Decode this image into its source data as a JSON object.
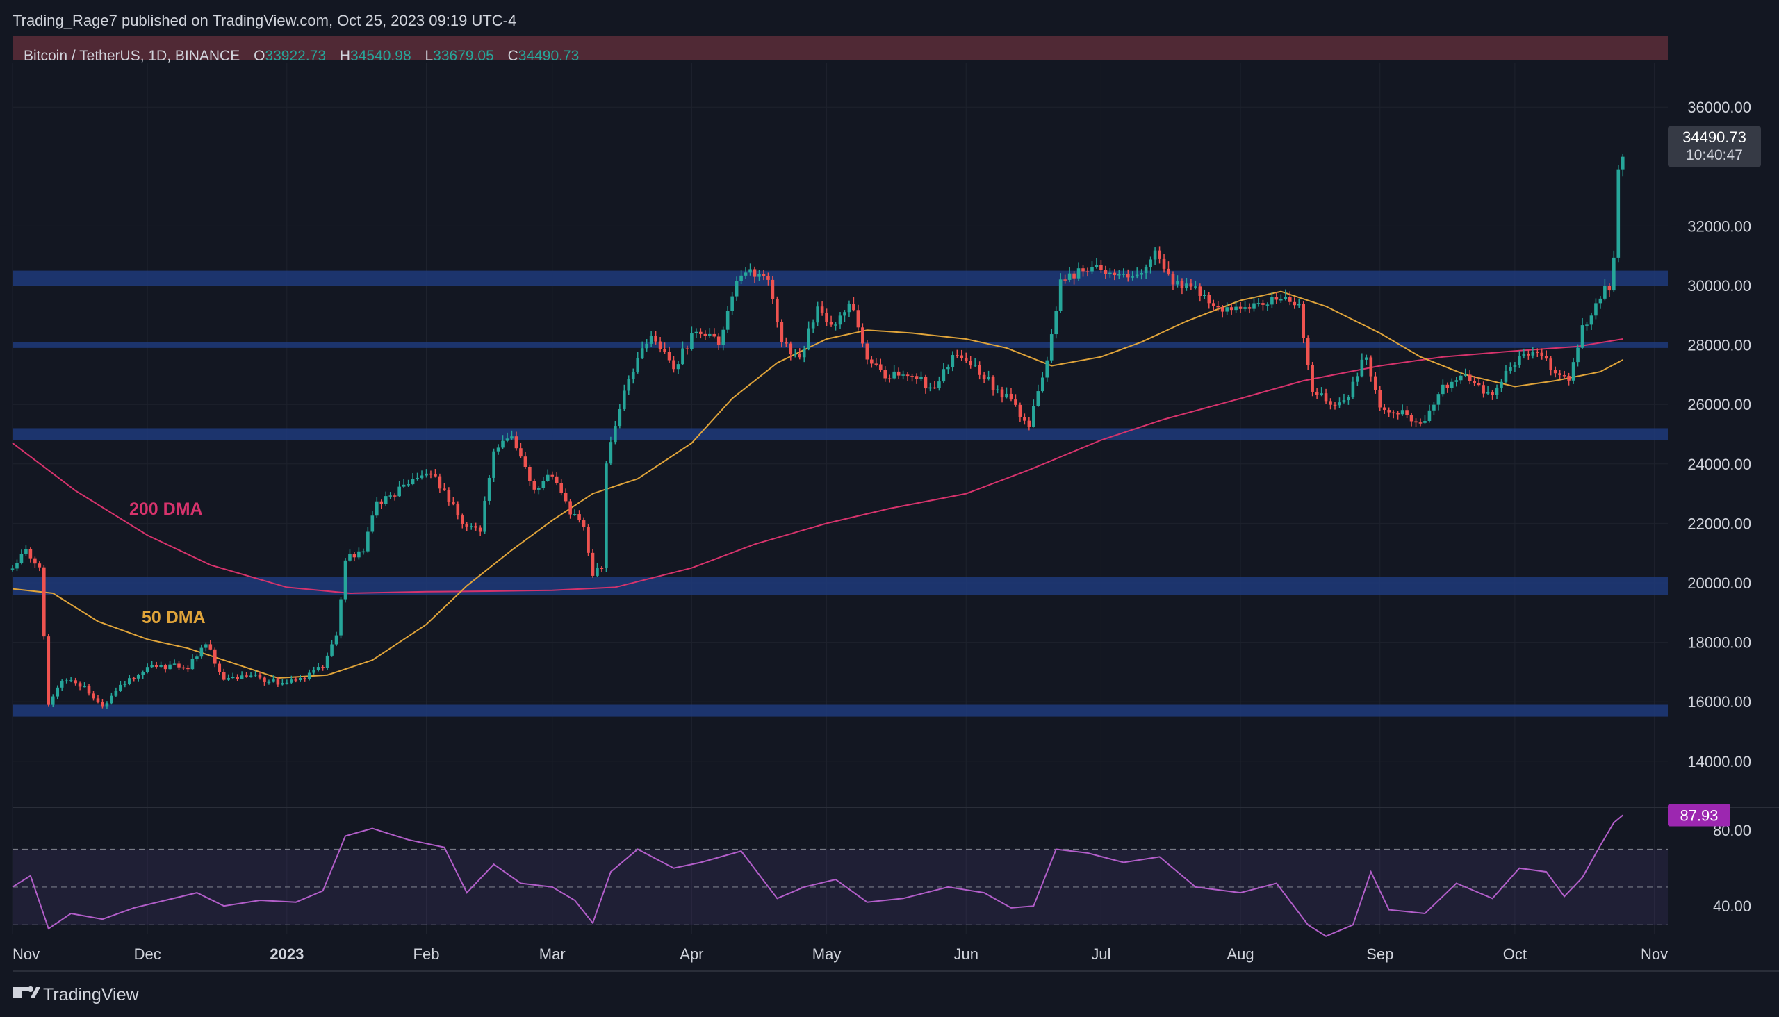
{
  "publisher_line": "Trading_Rage7 published on TradingView.com, Oct 25, 2023 09:19 UTC-4",
  "symbol": "Bitcoin / TetherUS, 1D, BINANCE",
  "ohlc": {
    "o_label": "O",
    "o_value": "33922.73",
    "h_label": "H",
    "h_value": "34540.98",
    "l_label": "L",
    "l_value": "33679.05",
    "c_label": "C",
    "c_value": "34490.73"
  },
  "last_price_tag": {
    "price": "34490.73",
    "countdown": "10:40:47"
  },
  "brand": "TradingView",
  "colors": {
    "background": "#131722",
    "text": "#d1d4dc",
    "up": "#26a69a",
    "down": "#ef5350",
    "dma50": "#e0a43a",
    "dma200": "#d6336c",
    "zone": "#1f3a7a",
    "rsi": "#b25ec9",
    "rsi_tag": "#9c27b0"
  },
  "chart_data": {
    "type": "candlestick",
    "interval": "1D",
    "y_axis": {
      "range": [
        12500,
        37500
      ],
      "ticks": [
        36000,
        32000,
        30000,
        28000,
        26000,
        24000,
        22000,
        20000,
        18000,
        16000,
        14000
      ],
      "tick_labels": [
        "36000.00",
        "32000.00",
        "30000.00",
        "28000.00",
        "26000.00",
        "24000.00",
        "22000.00",
        "20000.00",
        "18000.00",
        "16000.00",
        "14000.00"
      ]
    },
    "x_axis": {
      "range": [
        "2022-11-01",
        "2023-11-04"
      ],
      "ticks": [
        "2022-11-01",
        "2022-12-01",
        "2023-01-01",
        "2023-02-01",
        "2023-03-01",
        "2023-04-01",
        "2023-05-01",
        "2023-06-01",
        "2023-07-01",
        "2023-08-01",
        "2023-09-01",
        "2023-10-01",
        "2023-11-01"
      ],
      "tick_labels": [
        "Nov",
        "Dec",
        "2023",
        "Feb",
        "Mar",
        "Apr",
        "May",
        "Jun",
        "Jul",
        "Aug",
        "Sep",
        "Oct",
        "Nov"
      ]
    },
    "support_resistance_zones": [
      [
        30000,
        30500
      ],
      [
        24800,
        25200
      ],
      [
        19600,
        20200
      ],
      [
        15500,
        15900
      ],
      [
        27900,
        28100
      ]
    ],
    "annotations": [
      {
        "text": "200 DMA",
        "color": "#d6336c"
      },
      {
        "text": "50 DMA",
        "color": "#e0a43a"
      }
    ],
    "close_path": [
      [
        "2022-11-01",
        20450
      ],
      [
        "2022-11-04",
        21100
      ],
      [
        "2022-11-07",
        20600
      ],
      [
        "2022-11-09",
        15900
      ],
      [
        "2022-11-12",
        16800
      ],
      [
        "2022-11-16",
        16600
      ],
      [
        "2022-11-21",
        15800
      ],
      [
        "2022-11-25",
        16500
      ],
      [
        "2022-11-30",
        17100
      ],
      [
        "2022-12-05",
        17200
      ],
      [
        "2022-12-10",
        17150
      ],
      [
        "2022-12-14",
        18000
      ],
      [
        "2022-12-18",
        16700
      ],
      [
        "2022-12-25",
        16850
      ],
      [
        "2022-12-31",
        16550
      ],
      [
        "2023-01-05",
        16850
      ],
      [
        "2023-01-09",
        17200
      ],
      [
        "2023-01-12",
        18200
      ],
      [
        "2023-01-14",
        20800
      ],
      [
        "2023-01-18",
        21100
      ],
      [
        "2023-01-21",
        22700
      ],
      [
        "2023-01-26",
        23100
      ],
      [
        "2023-02-02",
        23700
      ],
      [
        "2023-02-09",
        22100
      ],
      [
        "2023-02-13",
        21800
      ],
      [
        "2023-02-16",
        24500
      ],
      [
        "2023-02-20",
        24800
      ],
      [
        "2023-02-25",
        23200
      ],
      [
        "2023-03-01",
        23600
      ],
      [
        "2023-03-05",
        22400
      ],
      [
        "2023-03-08",
        21900
      ],
      [
        "2023-03-10",
        20200
      ],
      [
        "2023-03-12",
        20600
      ],
      [
        "2023-03-13",
        24100
      ],
      [
        "2023-03-18",
        26900
      ],
      [
        "2023-03-23",
        28300
      ],
      [
        "2023-03-28",
        27200
      ],
      [
        "2023-04-02",
        28500
      ],
      [
        "2023-04-07",
        28100
      ],
      [
        "2023-04-11",
        30200
      ],
      [
        "2023-04-14",
        30500
      ],
      [
        "2023-04-18",
        30300
      ],
      [
        "2023-04-21",
        28200
      ],
      [
        "2023-04-25",
        27500
      ],
      [
        "2023-04-29",
        29300
      ],
      [
        "2023-05-02",
        28600
      ],
      [
        "2023-05-06",
        29500
      ],
      [
        "2023-05-10",
        27600
      ],
      [
        "2023-05-14",
        26900
      ],
      [
        "2023-05-20",
        27100
      ],
      [
        "2023-05-25",
        26400
      ],
      [
        "2023-05-29",
        27700
      ],
      [
        "2023-06-03",
        27200
      ],
      [
        "2023-06-08",
        26500
      ],
      [
        "2023-06-12",
        25900
      ],
      [
        "2023-06-15",
        25300
      ],
      [
        "2023-06-18",
        26800
      ],
      [
        "2023-06-20",
        28300
      ],
      [
        "2023-06-22",
        30100
      ],
      [
        "2023-06-27",
        30600
      ],
      [
        "2023-07-01",
        30500
      ],
      [
        "2023-07-05",
        30400
      ],
      [
        "2023-07-09",
        30200
      ],
      [
        "2023-07-13",
        31300
      ],
      [
        "2023-07-16",
        30200
      ],
      [
        "2023-07-22",
        29900
      ],
      [
        "2023-07-27",
        29300
      ],
      [
        "2023-08-02",
        29200
      ],
      [
        "2023-08-08",
        29600
      ],
      [
        "2023-08-14",
        29300
      ],
      [
        "2023-08-17",
        26500
      ],
      [
        "2023-08-20",
        26100
      ],
      [
        "2023-08-24",
        26000
      ],
      [
        "2023-08-29",
        27700
      ],
      [
        "2023-09-01",
        25900
      ],
      [
        "2023-09-05",
        25800
      ],
      [
        "2023-09-11",
        25300
      ],
      [
        "2023-09-14",
        26500
      ],
      [
        "2023-09-19",
        27000
      ],
      [
        "2023-09-25",
        26300
      ],
      [
        "2023-09-29",
        27000
      ],
      [
        "2023-10-02",
        27600
      ],
      [
        "2023-10-06",
        27800
      ],
      [
        "2023-10-10",
        27100
      ],
      [
        "2023-10-13",
        26900
      ],
      [
        "2023-10-16",
        28500
      ],
      [
        "2023-10-20",
        29700
      ],
      [
        "2023-10-22",
        30000
      ],
      [
        "2023-10-23",
        30800
      ],
      [
        "2023-10-24",
        33900
      ],
      [
        "2023-10-25",
        34490
      ]
    ],
    "dma_50": [
      [
        "2022-11-01",
        19800
      ],
      [
        "2022-11-10",
        19650
      ],
      [
        "2022-11-20",
        18700
      ],
      [
        "2022-12-01",
        18100
      ],
      [
        "2022-12-10",
        17800
      ],
      [
        "2022-12-20",
        17300
      ],
      [
        "2022-12-30",
        16800
      ],
      [
        "2023-01-10",
        16900
      ],
      [
        "2023-01-20",
        17400
      ],
      [
        "2023-02-01",
        18600
      ],
      [
        "2023-02-10",
        19900
      ],
      [
        "2023-02-20",
        21100
      ],
      [
        "2023-03-01",
        22100
      ],
      [
        "2023-03-10",
        23000
      ],
      [
        "2023-03-20",
        23500
      ],
      [
        "2023-04-01",
        24700
      ],
      [
        "2023-04-10",
        26200
      ],
      [
        "2023-04-20",
        27400
      ],
      [
        "2023-05-01",
        28200
      ],
      [
        "2023-05-10",
        28500
      ],
      [
        "2023-05-20",
        28400
      ],
      [
        "2023-06-01",
        28200
      ],
      [
        "2023-06-10",
        27900
      ],
      [
        "2023-06-20",
        27300
      ],
      [
        "2023-07-01",
        27600
      ],
      [
        "2023-07-10",
        28100
      ],
      [
        "2023-07-20",
        28800
      ],
      [
        "2023-08-01",
        29500
      ],
      [
        "2023-08-10",
        29800
      ],
      [
        "2023-08-20",
        29300
      ],
      [
        "2023-09-01",
        28400
      ],
      [
        "2023-09-10",
        27600
      ],
      [
        "2023-09-20",
        27000
      ],
      [
        "2023-10-01",
        26600
      ],
      [
        "2023-10-10",
        26800
      ],
      [
        "2023-10-20",
        27100
      ],
      [
        "2023-10-25",
        27500
      ]
    ],
    "dma_200": [
      [
        "2022-11-01",
        24700
      ],
      [
        "2022-11-15",
        23100
      ],
      [
        "2022-12-01",
        21600
      ],
      [
        "2022-12-15",
        20600
      ],
      [
        "2023-01-01",
        19850
      ],
      [
        "2023-01-15",
        19650
      ],
      [
        "2023-02-01",
        19700
      ],
      [
        "2023-02-15",
        19720
      ],
      [
        "2023-03-01",
        19750
      ],
      [
        "2023-03-15",
        19850
      ],
      [
        "2023-04-01",
        20500
      ],
      [
        "2023-04-15",
        21300
      ],
      [
        "2023-05-01",
        22000
      ],
      [
        "2023-05-15",
        22500
      ],
      [
        "2023-06-01",
        23000
      ],
      [
        "2023-06-15",
        23800
      ],
      [
        "2023-07-01",
        24800
      ],
      [
        "2023-07-15",
        25500
      ],
      [
        "2023-08-01",
        26200
      ],
      [
        "2023-08-15",
        26800
      ],
      [
        "2023-09-01",
        27300
      ],
      [
        "2023-09-15",
        27600
      ],
      [
        "2023-10-01",
        27800
      ],
      [
        "2023-10-15",
        27950
      ],
      [
        "2023-10-25",
        28200
      ]
    ],
    "rsi": {
      "period_label": "",
      "range": [
        25,
        90
      ],
      "ticks": [
        80,
        40
      ],
      "tick_labels": [
        "80.00",
        "40.00"
      ],
      "levels": [
        70,
        50,
        30
      ],
      "last_value": "87.93",
      "path": [
        [
          "2022-11-01",
          50
        ],
        [
          "2022-11-05",
          56
        ],
        [
          "2022-11-09",
          28
        ],
        [
          "2022-11-14",
          36
        ],
        [
          "2022-11-21",
          33
        ],
        [
          "2022-11-28",
          39
        ],
        [
          "2022-12-05",
          43
        ],
        [
          "2022-12-12",
          47
        ],
        [
          "2022-12-18",
          40
        ],
        [
          "2022-12-26",
          43
        ],
        [
          "2023-01-03",
          42
        ],
        [
          "2023-01-09",
          48
        ],
        [
          "2023-01-14",
          77
        ],
        [
          "2023-01-20",
          81
        ],
        [
          "2023-01-28",
          75
        ],
        [
          "2023-02-05",
          71
        ],
        [
          "2023-02-10",
          47
        ],
        [
          "2023-02-16",
          62
        ],
        [
          "2023-02-22",
          52
        ],
        [
          "2023-03-01",
          50
        ],
        [
          "2023-03-06",
          43
        ],
        [
          "2023-03-10",
          31
        ],
        [
          "2023-03-14",
          58
        ],
        [
          "2023-03-20",
          70
        ],
        [
          "2023-03-28",
          60
        ],
        [
          "2023-04-03",
          63
        ],
        [
          "2023-04-12",
          69
        ],
        [
          "2023-04-20",
          44
        ],
        [
          "2023-04-26",
          50
        ],
        [
          "2023-05-03",
          54
        ],
        [
          "2023-05-10",
          42
        ],
        [
          "2023-05-18",
          44
        ],
        [
          "2023-05-28",
          50
        ],
        [
          "2023-06-05",
          47
        ],
        [
          "2023-06-11",
          39
        ],
        [
          "2023-06-16",
          40
        ],
        [
          "2023-06-21",
          70
        ],
        [
          "2023-06-28",
          68
        ],
        [
          "2023-07-06",
          63
        ],
        [
          "2023-07-14",
          66
        ],
        [
          "2023-07-22",
          50
        ],
        [
          "2023-08-01",
          47
        ],
        [
          "2023-08-09",
          52
        ],
        [
          "2023-08-16",
          30
        ],
        [
          "2023-08-20",
          24
        ],
        [
          "2023-08-26",
          30
        ],
        [
          "2023-08-30",
          58
        ],
        [
          "2023-09-03",
          38
        ],
        [
          "2023-09-11",
          36
        ],
        [
          "2023-09-18",
          52
        ],
        [
          "2023-09-26",
          44
        ],
        [
          "2023-10-02",
          60
        ],
        [
          "2023-10-08",
          58
        ],
        [
          "2023-10-12",
          45
        ],
        [
          "2023-10-16",
          55
        ],
        [
          "2023-10-20",
          72
        ],
        [
          "2023-10-23",
          84
        ],
        [
          "2023-10-25",
          88
        ]
      ]
    }
  }
}
